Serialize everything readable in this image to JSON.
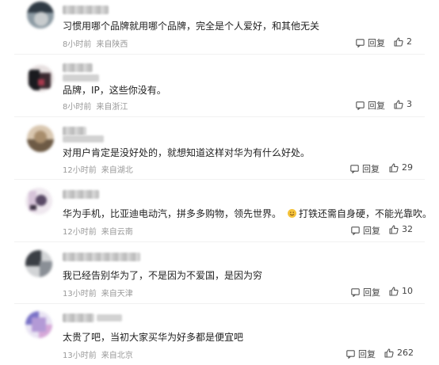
{
  "comments": [
    {
      "text": "习惯用哪个品牌就用哪个品牌，完全是个人爱好，和其他无关",
      "time": "8小时前",
      "location": "来自陕西",
      "reply_label": "回复",
      "likes": "2",
      "avatar_colors": [
        "#2f3a44",
        "#8c9aa3",
        "#c8ccce"
      ]
    },
    {
      "text": "品牌，IP，这些你没有。",
      "time": "8小时前",
      "location": "来自浙江",
      "reply_label": "回复",
      "likes": "3",
      "avatar_colors": [
        "#1a1a1f",
        "#a73a4e",
        "#e7e0e0"
      ]
    },
    {
      "text": "对用户肯定是没好处的，就想知道这样对华为有什么好处。",
      "time": "12小时前",
      "location": "来自湖北",
      "reply_label": "回复",
      "likes": "29",
      "avatar_colors": [
        "#a88d6c",
        "#6d5a45",
        "#d9c7b0"
      ]
    },
    {
      "text_before": "华为手机，比亚迪电动汽，拼多多购物，领先世界。",
      "text_after": "打铁还需自身硬，不能光靠吹。",
      "time": "12小时前",
      "location": "来自云南",
      "reply_label": "回复",
      "likes": "32",
      "avatar_colors": [
        "#5a4a66",
        "#d7c4d9",
        "#efe8ef"
      ]
    },
    {
      "text": "我已经告别华为了，不是因为不爱国，是因为穷",
      "time": "13小时前",
      "location": "来自天津",
      "reply_label": "回复",
      "likes": "10",
      "avatar_colors": [
        "#3b3f45",
        "#8a8f96",
        "#d2d4d6"
      ]
    },
    {
      "text": "太贵了吧，当初大家买华为好多都是便宜吧",
      "time": "13小时前",
      "location": "来自北京",
      "reply_label": "回复",
      "likes": "262",
      "avatar_colors": [
        "#7a73c7",
        "#d6a8d8",
        "#e9e4f3"
      ]
    }
  ],
  "icons": {
    "reply": "reply-icon",
    "like": "thumbs-up-icon",
    "emoji": "smile-emoji-icon"
  }
}
